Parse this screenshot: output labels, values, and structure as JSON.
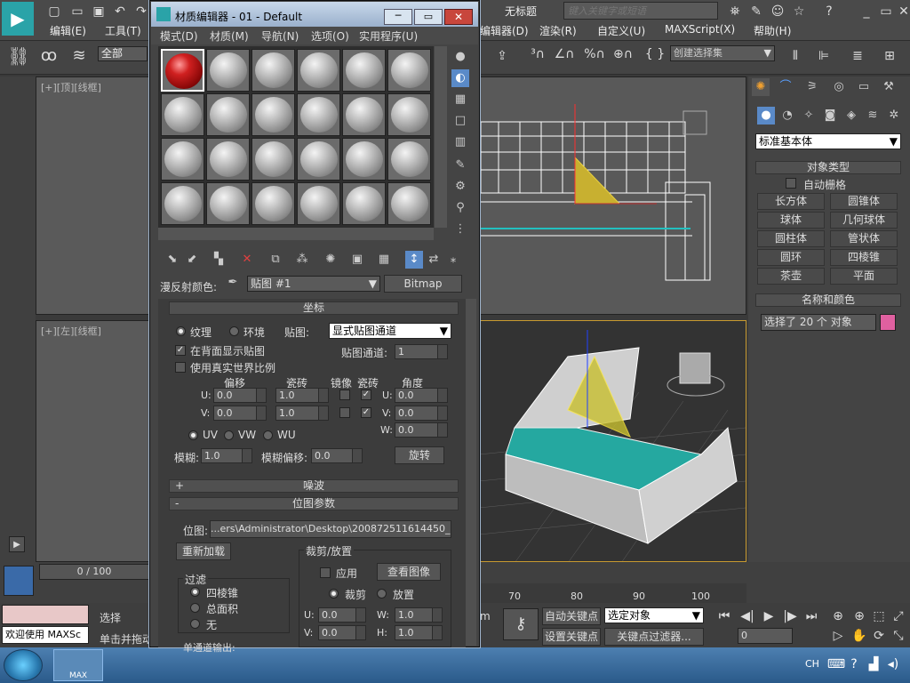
{
  "app": {
    "title": "无标题",
    "search_placeholder": "键入关键字或短语",
    "menu": [
      "编辑(E)",
      "工具(T)",
      "编辑器(D)",
      "渲染(R)",
      "自定义(U)",
      "MAXScript(X)",
      "帮助(H)"
    ],
    "selection_filter": "全部",
    "named_selection": "创建选择集"
  },
  "viewports": {
    "top_label": "[+][顶][线框]",
    "left_label": "[+][左][线框]"
  },
  "mat_editor": {
    "title": "材质编辑器 - 01 - Default",
    "menu": [
      "模式(D)",
      "材质(M)",
      "导航(N)",
      "选项(O)",
      "实用程序(U)"
    ],
    "diffuse_label": "漫反射颜色:",
    "map_name": "贴图 #1",
    "map_type": "Bitmap",
    "coords": {
      "header": "坐标",
      "texture": "纹理",
      "environ": "环境",
      "mapping_label": "贴图:",
      "mapping_value": "显式贴图通道",
      "show_back": "在背面显示贴图",
      "map_channel_label": "贴图通道:",
      "map_channel": "1",
      "real_world": "使用真实世界比例",
      "offset": "偏移",
      "tiling": "瓷砖",
      "mirror": "镜像",
      "tile": "瓷砖",
      "angle": "角度",
      "u_label": "U:",
      "v_label": "V:",
      "w_label": "W:",
      "u_offset": "0.0",
      "v_offset": "0.0",
      "u_tiling": "1.0",
      "v_tiling": "1.0",
      "u_angle": "0.0",
      "v_angle": "0.0",
      "w_angle": "0.0",
      "uv": "UV",
      "vw": "VW",
      "wu": "WU",
      "blur_label": "模糊:",
      "blur": "1.0",
      "blur_offset_label": "模糊偏移:",
      "blur_offset": "0.0",
      "rotate": "旋转"
    },
    "noise_header": "噪波",
    "bitmap_header": "位图参数",
    "bitmap_label": "位图:",
    "bitmap_path": "...ers\\Administrator\\Desktop\\200872511614450_2.jpg",
    "reload": "重新加载",
    "crop_header": "裁剪/放置",
    "apply": "应用",
    "view_image": "查看图像",
    "crop": "裁剪",
    "place": "放置",
    "filter_header": "过滤",
    "pyramidal": "四棱锥",
    "summed": "总面积",
    "none": "无",
    "crop_u": "0.0",
    "crop_v": "0.0",
    "crop_w": "1.0",
    "crop_h": "1.0",
    "mono_output": "单通道输出:",
    "crop_u_label": "U:",
    "crop_v_label": "V:",
    "crop_w_label": "W:",
    "crop_h_label": "H:"
  },
  "right_panel": {
    "category": "标准基本体",
    "object_type": "对象类型",
    "autogrid": "自动栅格",
    "buttons": [
      "长方体",
      "圆锥体",
      "球体",
      "几何球体",
      "圆柱体",
      "管状体",
      "圆环",
      "四棱锥",
      "茶壶",
      "平面"
    ],
    "name_color": "名称和颜色",
    "selected_text": "选择了 20 个 对象",
    "color_swatch": "#e060a0"
  },
  "timeline": {
    "frame": "0 / 100",
    "ticks": [
      "70",
      "80",
      "90",
      "100"
    ]
  },
  "status": {
    "welcome": "欢迎使用 MAXSc",
    "select": "选择",
    "click_drag": "单击并拖动",
    "auto_key": "自动关键点",
    "set_key": "设置关键点",
    "selected_obj": "选定对象",
    "key_filter": "关键点过滤器...",
    "frame_input": "0",
    "m_label": "m"
  },
  "taskbar": {
    "lang": "CH",
    "app_label": "MAX"
  }
}
